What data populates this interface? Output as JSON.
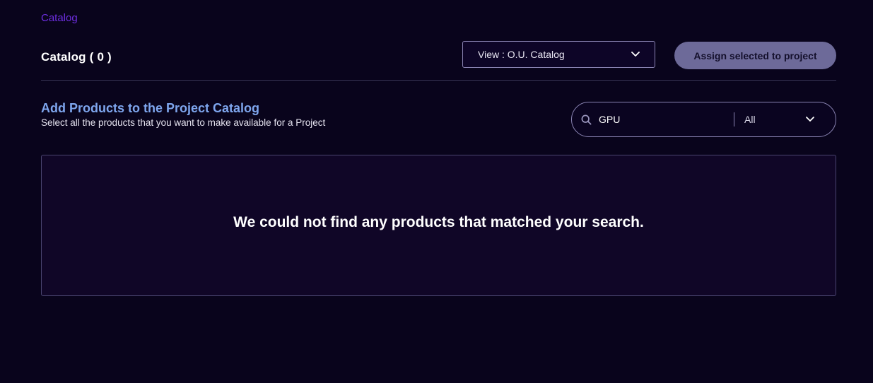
{
  "breadcrumb": {
    "label": "Catalog"
  },
  "header": {
    "title": "Catalog ( 0 )",
    "view_select": {
      "label": "View : O.U. Catalog",
      "icon": "chevron-down-icon"
    },
    "assign_button": {
      "label": "Assign selected to project"
    }
  },
  "section": {
    "title": "Add Products to the Project Catalog",
    "subtitle": "Select all the products that you want to make available for a Project"
  },
  "search": {
    "value": "GPU",
    "icon": "search-icon",
    "filter": {
      "label": "All",
      "icon": "chevron-down-icon"
    }
  },
  "results": {
    "empty_message": "We could not find any products that matched your search."
  },
  "colors": {
    "background": "#09041c",
    "breadcrumb": "#6d2ee0",
    "section_title": "#7ea6ee",
    "assign_button_bg": "#6d6a99",
    "border": "#8a84b3"
  }
}
